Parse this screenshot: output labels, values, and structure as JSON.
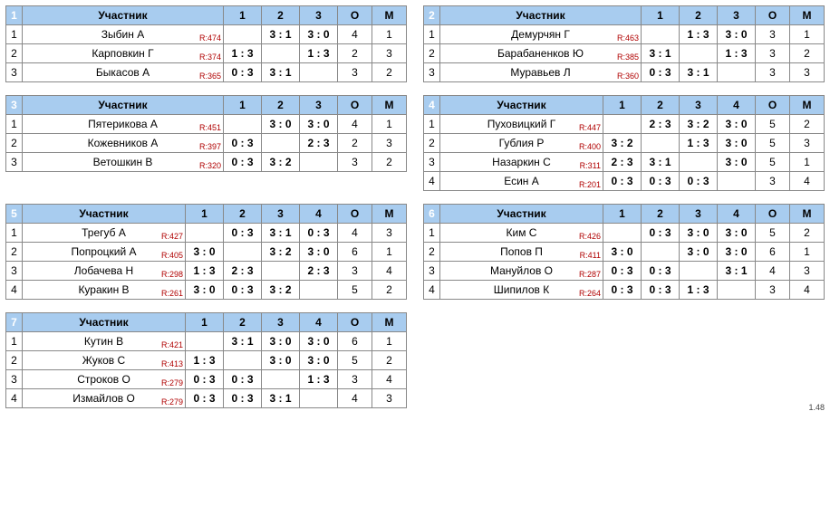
{
  "labels": {
    "participant": "Участник",
    "o": "О",
    "m": "М"
  },
  "footer": "1.48",
  "groups": [
    {
      "num": "1",
      "size": 3,
      "players": [
        {
          "idx": "1",
          "name": "Зыбин А",
          "rating": "R:474",
          "cells": [
            null,
            {
              "s": "3 : 1",
              "r": "w"
            },
            {
              "s": "3 : 0",
              "r": "w"
            }
          ],
          "o": "4",
          "m": "1"
        },
        {
          "idx": "2",
          "name": "Карповкин Г",
          "rating": "R:374",
          "cells": [
            {
              "s": "1 : 3",
              "r": "l"
            },
            null,
            {
              "s": "1 : 3",
              "r": "l"
            }
          ],
          "o": "2",
          "m": "3"
        },
        {
          "idx": "3",
          "name": "Быкасов А",
          "rating": "R:365",
          "cells": [
            {
              "s": "0 : 3",
              "r": "l"
            },
            {
              "s": "3 : 1",
              "r": "w"
            },
            null
          ],
          "o": "3",
          "m": "2"
        }
      ]
    },
    {
      "num": "2",
      "size": 3,
      "players": [
        {
          "idx": "1",
          "name": "Демурчян Г",
          "rating": "R:463",
          "cells": [
            null,
            {
              "s": "1 : 3",
              "r": "l"
            },
            {
              "s": "3 : 0",
              "r": "w"
            }
          ],
          "o": "3",
          "m": "1"
        },
        {
          "idx": "2",
          "name": "Барабаненков Ю",
          "rating": "R:385",
          "cells": [
            {
              "s": "3 : 1",
              "r": "w"
            },
            null,
            {
              "s": "1 : 3",
              "r": "l"
            }
          ],
          "o": "3",
          "m": "2"
        },
        {
          "idx": "3",
          "name": "Муравьев Л",
          "rating": "R:360",
          "cells": [
            {
              "s": "0 : 3",
              "r": "l"
            },
            {
              "s": "3 : 1",
              "r": "w"
            },
            null
          ],
          "o": "3",
          "m": "3"
        }
      ]
    },
    {
      "num": "3",
      "size": 3,
      "players": [
        {
          "idx": "1",
          "name": "Пятерикова А",
          "rating": "R:451",
          "cells": [
            null,
            {
              "s": "3 : 0",
              "r": "w"
            },
            {
              "s": "3 : 0",
              "r": "w"
            }
          ],
          "o": "4",
          "m": "1"
        },
        {
          "idx": "2",
          "name": "Кожевников А",
          "rating": "R:397",
          "cells": [
            {
              "s": "0 : 3",
              "r": "l"
            },
            null,
            {
              "s": "2 : 3",
              "r": "l"
            }
          ],
          "o": "2",
          "m": "3"
        },
        {
          "idx": "3",
          "name": "Ветошкин В",
          "rating": "R:320",
          "cells": [
            {
              "s": "0 : 3",
              "r": "l"
            },
            {
              "s": "3 : 2",
              "r": "w"
            },
            null
          ],
          "o": "3",
          "m": "2"
        }
      ]
    },
    {
      "num": "4",
      "size": 4,
      "players": [
        {
          "idx": "1",
          "name": "Пуховицкий Г",
          "rating": "R:447",
          "cells": [
            null,
            {
              "s": "2 : 3",
              "r": "l"
            },
            {
              "s": "3 : 2",
              "r": "w"
            },
            {
              "s": "3 : 0",
              "r": "w"
            }
          ],
          "o": "5",
          "m": "2"
        },
        {
          "idx": "2",
          "name": "Гублия Р",
          "rating": "R:400",
          "cells": [
            {
              "s": "3 : 2",
              "r": "w"
            },
            null,
            {
              "s": "1 : 3",
              "r": "l"
            },
            {
              "s": "3 : 0",
              "r": "w"
            }
          ],
          "o": "5",
          "m": "3"
        },
        {
          "idx": "3",
          "name": "Назаркин С",
          "rating": "R:311",
          "cells": [
            {
              "s": "2 : 3",
              "r": "l"
            },
            {
              "s": "3 : 1",
              "r": "w"
            },
            null,
            {
              "s": "3 : 0",
              "r": "w"
            }
          ],
          "o": "5",
          "m": "1"
        },
        {
          "idx": "4",
          "name": "Есин А",
          "rating": "R:201",
          "cells": [
            {
              "s": "0 : 3",
              "r": "l"
            },
            {
              "s": "0 : 3",
              "r": "l"
            },
            {
              "s": "0 : 3",
              "r": "l"
            },
            null
          ],
          "o": "3",
          "m": "4"
        }
      ]
    },
    {
      "num": "5",
      "size": 4,
      "players": [
        {
          "idx": "1",
          "name": "Трегуб А",
          "rating": "R:427",
          "cells": [
            null,
            {
              "s": "0 : 3",
              "r": "l"
            },
            {
              "s": "3 : 1",
              "r": "w"
            },
            {
              "s": "0 : 3",
              "r": "l"
            }
          ],
          "o": "4",
          "m": "3"
        },
        {
          "idx": "2",
          "name": "Попроцкий А",
          "rating": "R:405",
          "cells": [
            {
              "s": "3 : 0",
              "r": "w"
            },
            null,
            {
              "s": "3 : 2",
              "r": "w"
            },
            {
              "s": "3 : 0",
              "r": "w"
            }
          ],
          "o": "6",
          "m": "1"
        },
        {
          "idx": "3",
          "name": "Лобачева Н",
          "rating": "R:298",
          "cells": [
            {
              "s": "1 : 3",
              "r": "l"
            },
            {
              "s": "2 : 3",
              "r": "l"
            },
            null,
            {
              "s": "2 : 3",
              "r": "l"
            }
          ],
          "o": "3",
          "m": "4"
        },
        {
          "idx": "4",
          "name": "Куракин В",
          "rating": "R:261",
          "cells": [
            {
              "s": "3 : 0",
              "r": "w"
            },
            {
              "s": "0 : 3",
              "r": "l"
            },
            {
              "s": "3 : 2",
              "r": "w"
            },
            null
          ],
          "o": "5",
          "m": "2"
        }
      ]
    },
    {
      "num": "6",
      "size": 4,
      "players": [
        {
          "idx": "1",
          "name": "Ким С",
          "rating": "R:426",
          "cells": [
            null,
            {
              "s": "0 : 3",
              "r": "l"
            },
            {
              "s": "3 : 0",
              "r": "w"
            },
            {
              "s": "3 : 0",
              "r": "w"
            }
          ],
          "o": "5",
          "m": "2"
        },
        {
          "idx": "2",
          "name": "Попов П",
          "rating": "R:411",
          "cells": [
            {
              "s": "3 : 0",
              "r": "w"
            },
            null,
            {
              "s": "3 : 0",
              "r": "w"
            },
            {
              "s": "3 : 0",
              "r": "w"
            }
          ],
          "o": "6",
          "m": "1"
        },
        {
          "idx": "3",
          "name": "Мануйлов О",
          "rating": "R:287",
          "cells": [
            {
              "s": "0 : 3",
              "r": "l"
            },
            {
              "s": "0 : 3",
              "r": "l"
            },
            null,
            {
              "s": "3 : 1",
              "r": "w"
            }
          ],
          "o": "4",
          "m": "3"
        },
        {
          "idx": "4",
          "name": "Шипилов К",
          "rating": "R:264",
          "cells": [
            {
              "s": "0 : 3",
              "r": "l"
            },
            {
              "s": "0 : 3",
              "r": "l"
            },
            {
              "s": "1 : 3",
              "r": "l"
            },
            null
          ],
          "o": "3",
          "m": "4"
        }
      ]
    },
    {
      "num": "7",
      "size": 4,
      "players": [
        {
          "idx": "1",
          "name": "Кутин В",
          "rating": "R:421",
          "cells": [
            null,
            {
              "s": "3 : 1",
              "r": "w"
            },
            {
              "s": "3 : 0",
              "r": "w"
            },
            {
              "s": "3 : 0",
              "r": "w"
            }
          ],
          "o": "6",
          "m": "1"
        },
        {
          "idx": "2",
          "name": "Жуков С",
          "rating": "R:413",
          "cells": [
            {
              "s": "1 : 3",
              "r": "l"
            },
            null,
            {
              "s": "3 : 0",
              "r": "w"
            },
            {
              "s": "3 : 0",
              "r": "w"
            }
          ],
          "o": "5",
          "m": "2"
        },
        {
          "idx": "3",
          "name": "Строков О",
          "rating": "R:279",
          "cells": [
            {
              "s": "0 : 3",
              "r": "l"
            },
            {
              "s": "0 : 3",
              "r": "l"
            },
            null,
            {
              "s": "1 : 3",
              "r": "l"
            }
          ],
          "o": "3",
          "m": "4"
        },
        {
          "idx": "4",
          "name": "Измайлов О",
          "rating": "R:279",
          "cells": [
            {
              "s": "0 : 3",
              "r": "l"
            },
            {
              "s": "0 : 3",
              "r": "l"
            },
            {
              "s": "3 : 1",
              "r": "w"
            },
            null
          ],
          "o": "4",
          "m": "3"
        }
      ]
    }
  ]
}
